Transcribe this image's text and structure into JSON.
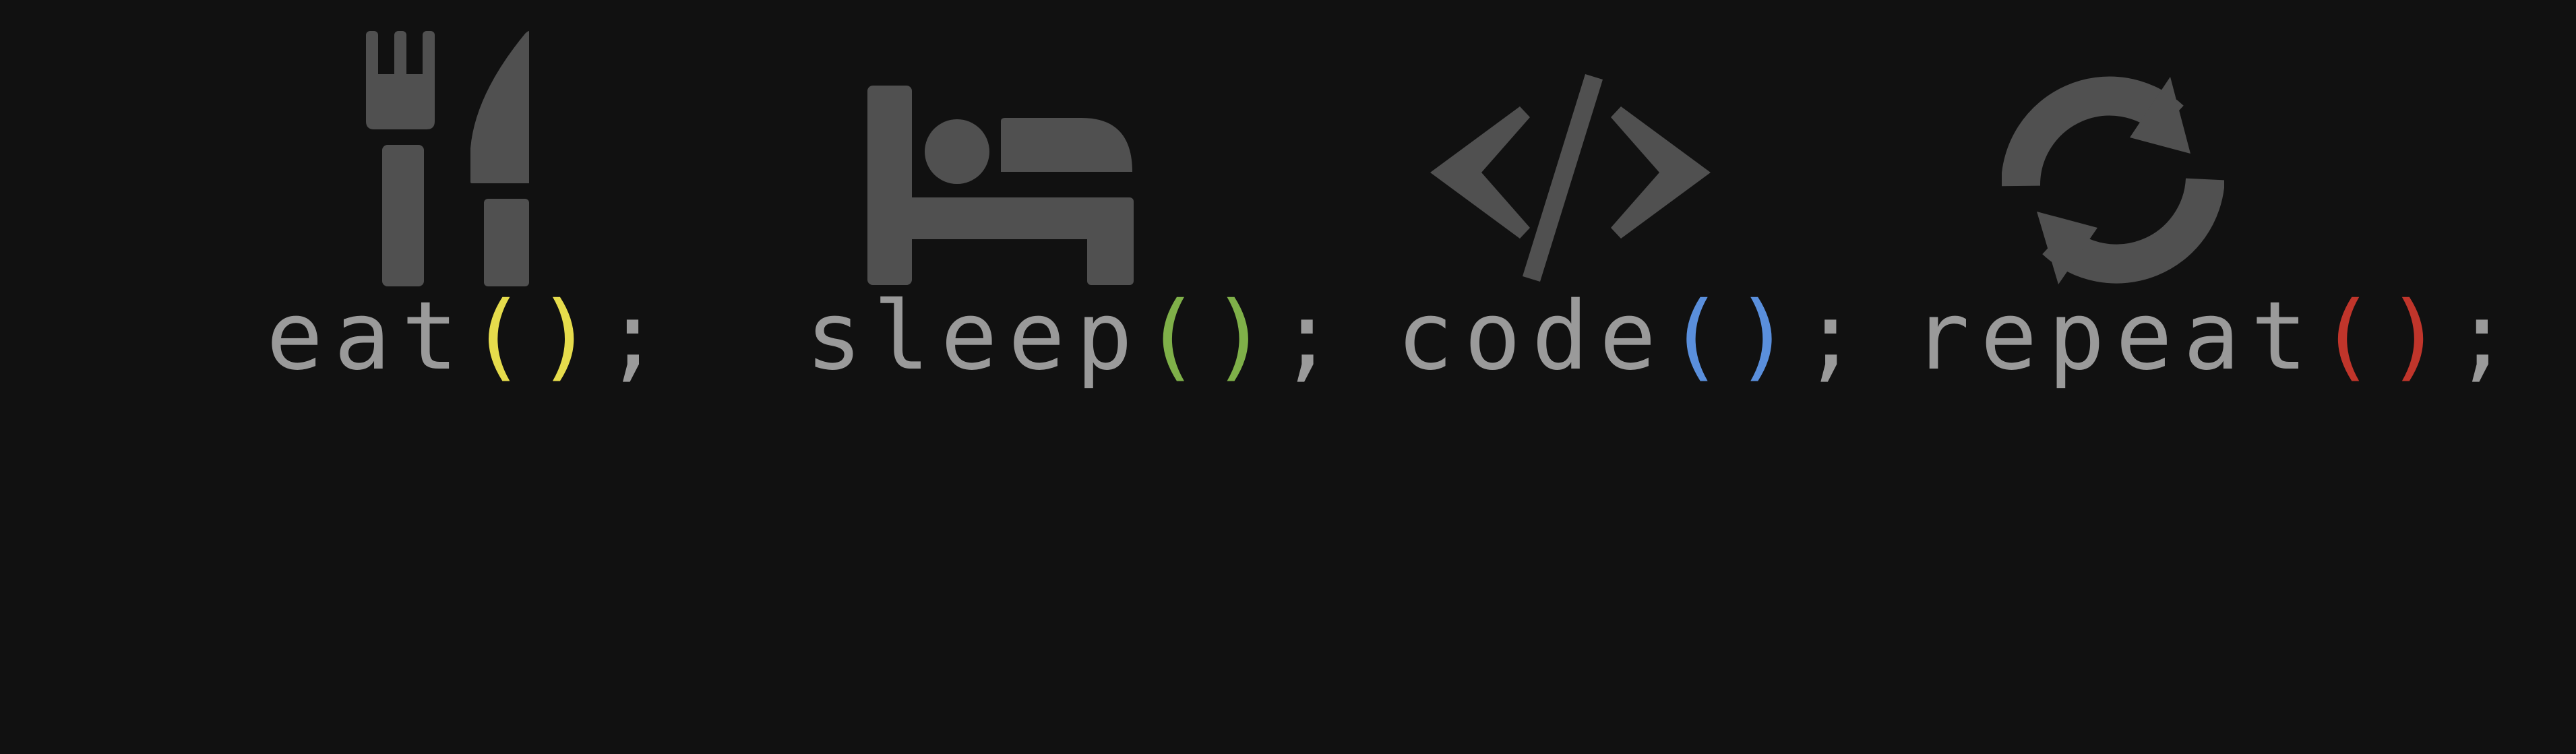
{
  "colors": {
    "background": "#111111",
    "icon": "#505050",
    "text": "#9a9a9a"
  },
  "items": [
    {
      "icon": "fork-knife-icon",
      "name": "eat",
      "open": "(",
      "close": ")",
      "end": ";",
      "paren_color": "#e6dc4c"
    },
    {
      "icon": "bed-icon",
      "name": "sleep",
      "open": "(",
      "close": ")",
      "end": ";",
      "paren_color": "#7fb049"
    },
    {
      "icon": "code-brackets-icon",
      "name": "code",
      "open": "(",
      "close": ")",
      "end": ";",
      "paren_color": "#5a8fdc"
    },
    {
      "icon": "refresh-cycle-icon",
      "name": "repeat",
      "open": "(",
      "close": ")",
      "end": ";",
      "paren_color": "#c0352b"
    }
  ]
}
